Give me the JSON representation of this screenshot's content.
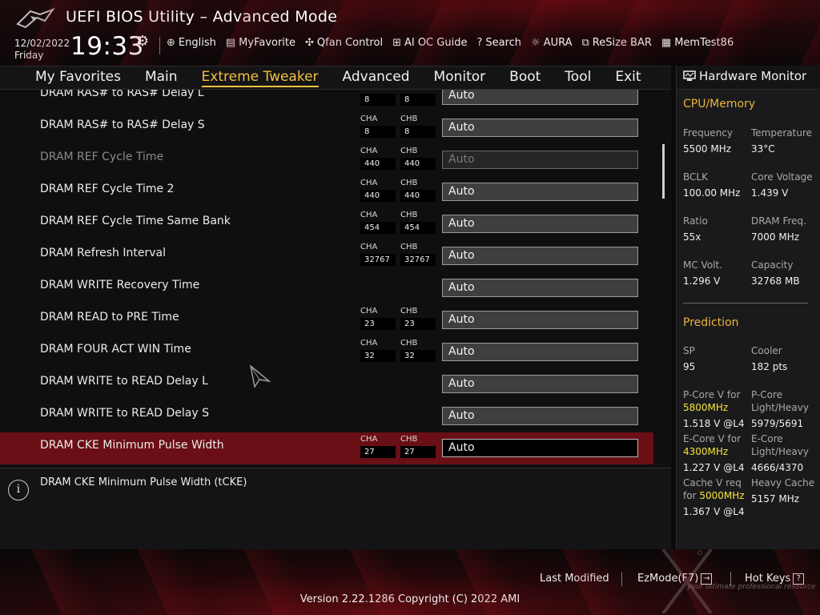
{
  "header": {
    "title": "UEFI BIOS Utility – Advanced Mode",
    "date": "12/02/2022",
    "day": "Friday",
    "time": "19:33",
    "toolbar": [
      {
        "icon": "globe-icon",
        "glyph": "⊕",
        "label": "English"
      },
      {
        "icon": "favorite-icon",
        "glyph": "▤",
        "label": "MyFavorite"
      },
      {
        "icon": "fan-icon",
        "glyph": "✣",
        "label": "Qfan Control"
      },
      {
        "icon": "ai-chip-icon",
        "glyph": "⊞",
        "label": "AI OC Guide"
      },
      {
        "icon": "search-icon",
        "glyph": "?",
        "label": "Search"
      },
      {
        "icon": "aura-icon",
        "glyph": "☼",
        "label": "AURA"
      },
      {
        "icon": "resize-bar-icon",
        "glyph": "⧉",
        "label": "ReSize BAR"
      },
      {
        "icon": "memtest-icon",
        "glyph": "▦",
        "label": "MemTest86"
      }
    ]
  },
  "nav": {
    "tabs": [
      "My Favorites",
      "Main",
      "Extreme Tweaker",
      "Advanced",
      "Monitor",
      "Boot",
      "Tool",
      "Exit"
    ],
    "active": "Extreme Tweaker"
  },
  "settings": [
    {
      "label": "DRAM RAS# to RAS# Delay L",
      "cha": "8",
      "chb": "8",
      "value": "Auto",
      "state": "normal"
    },
    {
      "label": "DRAM RAS# to RAS# Delay S",
      "cha": "8",
      "chb": "8",
      "value": "Auto",
      "state": "normal"
    },
    {
      "label": "DRAM REF Cycle Time",
      "cha": "440",
      "chb": "440",
      "value": "Auto",
      "state": "disabled"
    },
    {
      "label": "DRAM REF Cycle Time 2",
      "cha": "440",
      "chb": "440",
      "value": "Auto",
      "state": "normal"
    },
    {
      "label": "DRAM REF Cycle Time Same Bank",
      "cha": "454",
      "chb": "454",
      "value": "Auto",
      "state": "normal"
    },
    {
      "label": "DRAM Refresh Interval",
      "cha": "32767",
      "chb": "32767",
      "value": "Auto",
      "state": "normal"
    },
    {
      "label": "DRAM WRITE Recovery Time",
      "cha": null,
      "chb": null,
      "value": "Auto",
      "state": "normal"
    },
    {
      "label": "DRAM READ to PRE Time",
      "cha": "23",
      "chb": "23",
      "value": "Auto",
      "state": "normal"
    },
    {
      "label": "DRAM FOUR ACT WIN Time",
      "cha": "32",
      "chb": "32",
      "value": "Auto",
      "state": "normal"
    },
    {
      "label": "DRAM WRITE to READ Delay L",
      "cha": null,
      "chb": null,
      "value": "Auto",
      "state": "normal"
    },
    {
      "label": "DRAM WRITE to READ Delay S",
      "cha": null,
      "chb": null,
      "value": "Auto",
      "state": "normal"
    },
    {
      "label": "DRAM CKE Minimum Pulse Width",
      "cha": "27",
      "chb": "27",
      "value": "Auto",
      "state": "selected"
    }
  ],
  "channel_labels": {
    "a": "CHA",
    "b": "CHB"
  },
  "help": {
    "text": "DRAM CKE Minimum Pulse Width (tCKE)"
  },
  "hardware_monitor": {
    "title": "Hardware Monitor",
    "cpu_memory": {
      "heading": "CPU/Memory",
      "items": [
        {
          "key": "Frequency",
          "value": "5500 MHz"
        },
        {
          "key": "Temperature",
          "value": "33°C"
        },
        {
          "key": "BCLK",
          "value": "100.00 MHz"
        },
        {
          "key": "Core Voltage",
          "value": "1.439 V"
        },
        {
          "key": "Ratio",
          "value": "55x"
        },
        {
          "key": "DRAM Freq.",
          "value": "7000 MHz"
        },
        {
          "key": "MC Volt.",
          "value": "1.296 V"
        },
        {
          "key": "Capacity",
          "value": "32768 MB"
        }
      ]
    },
    "prediction": {
      "heading": "Prediction",
      "sp_key": "SP",
      "sp_value": "95",
      "cooler_key": "Cooler",
      "cooler_value": "182 pts",
      "pcore_v_key": "P-Core V for",
      "pcore_v_freq": "5800MHz",
      "pcore_v_value": "1.518 V @L4",
      "pcore_lh_key1": "P-Core",
      "pcore_lh_key2": "Light/Heavy",
      "pcore_lh_value": "5979/5691",
      "ecore_v_key": "E-Core V for",
      "ecore_v_freq": "4300MHz",
      "ecore_v_value": "1.227 V @L4",
      "ecore_lh_key1": "E-Core",
      "ecore_lh_key2": "Light/Heavy",
      "ecore_lh_value": "4666/4370",
      "cache_v_key1": "Cache V req",
      "cache_v_key2": "for",
      "cache_v_freq": "5000MHz",
      "cache_v_value": "1.367 V @L4",
      "heavy_cache_key": "Heavy Cache",
      "heavy_cache_value": "5157 MHz"
    }
  },
  "footer": {
    "last_modified": "Last Modified",
    "ezmode": "EzMode(F7)",
    "ezmode_glyph": "→",
    "hotkeys": "Hot Keys",
    "hotkeys_glyph": "?",
    "version": "Version 2.22.1286 Copyright (C) 2022 AMI",
    "watermark": "your ultimate professional resource"
  },
  "colors": {
    "accent": "#f3c141",
    "selected_row": "#6a0f15",
    "highlight_freq": "#f7e23c",
    "section_heading": "#e9b53a"
  }
}
